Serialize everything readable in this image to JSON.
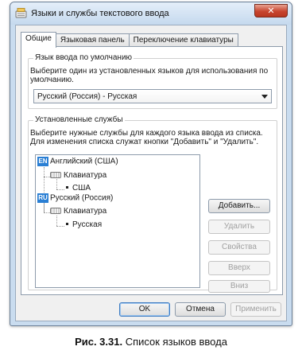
{
  "window": {
    "title": "Языки и службы текстового ввода",
    "close_glyph": "✕"
  },
  "tabs": [
    {
      "label": "Общие",
      "active": true
    },
    {
      "label": "Языковая панель",
      "active": false
    },
    {
      "label": "Переключение клавиатуры",
      "active": false
    }
  ],
  "default_language": {
    "group_title": "Язык ввода по умолчанию",
    "description": "Выберите один из установленных языков для использования по умолчанию.",
    "selected": "Русский (Россия) - Русская"
  },
  "services": {
    "group_title": "Установленные службы",
    "description": "Выберите нужные службы для каждого языка ввода из списка. Для изменения списка служат кнопки \"Добавить\" и \"Удалить\".",
    "tree": [
      {
        "badge": "EN",
        "language": "Английский (США)",
        "category": "Клавиатура",
        "layout": "США"
      },
      {
        "badge": "RU",
        "language": "Русский (Россия)",
        "category": "Клавиатура",
        "layout": "Русская"
      }
    ],
    "buttons": {
      "add": "Добавить...",
      "remove": "Удалить",
      "properties": "Свойства",
      "up": "Вверх",
      "down": "Вниз"
    }
  },
  "footer": {
    "ok": "OK",
    "cancel": "Отмена",
    "apply": "Применить"
  },
  "caption": {
    "number": "Рис. 3.31.",
    "text": "Список языков ввода"
  },
  "colors": {
    "accent": "#2a7fd4",
    "close": "#c8452f"
  }
}
